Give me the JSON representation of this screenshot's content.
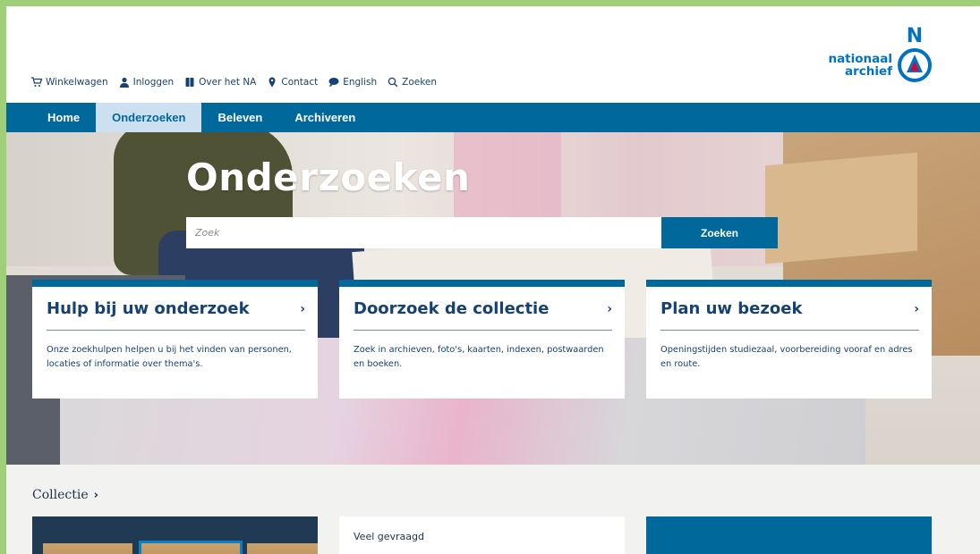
{
  "util_nav": [
    {
      "label": "Winkelwagen",
      "icon": "cart-icon"
    },
    {
      "label": "Inloggen",
      "icon": "user-icon"
    },
    {
      "label": "Over het NA",
      "icon": "book-icon"
    },
    {
      "label": "Contact",
      "icon": "map-pin-icon"
    },
    {
      "label": "English",
      "icon": "speech-bubble-icon"
    },
    {
      "label": "Zoeken",
      "icon": "search-icon"
    }
  ],
  "logo": {
    "line1": "nationaal",
    "line2": "archief",
    "letter": "N",
    "brand_color": "#0072c6",
    "accent_red": "#e4002b"
  },
  "main_nav": [
    {
      "label": "Home",
      "active": false
    },
    {
      "label": "Onderzoeken",
      "active": true
    },
    {
      "label": "Beleven",
      "active": false
    },
    {
      "label": "Archiveren",
      "active": false
    }
  ],
  "hero": {
    "title": "Onderzoeken",
    "search_placeholder": "Zoek",
    "search_button": "Zoeken"
  },
  "cards": [
    {
      "title": "Hulp bij uw onderzoek",
      "chevron": "›",
      "text": "Onze zoekhulpen helpen u bij het vinden van personen, locaties of informatie over thema's."
    },
    {
      "title": "Doorzoek de collectie",
      "chevron": "›",
      "text": "Zoek in archieven, foto's, kaarten, indexen, postwaarden en boeken."
    },
    {
      "title": "Plan uw bezoek",
      "chevron": "›",
      "text": "Openingstijden studiezaal, voorbereiding vooraf en adres en route."
    }
  ],
  "collectie": {
    "heading": "Collectie",
    "chevron": "›",
    "faq_title": "Veel gevraagd"
  },
  "colors": {
    "nav_blue": "#01689b",
    "nav_active_bg": "#cce0f1",
    "text_navy": "#154273",
    "frame_green": "#9fcf77"
  }
}
